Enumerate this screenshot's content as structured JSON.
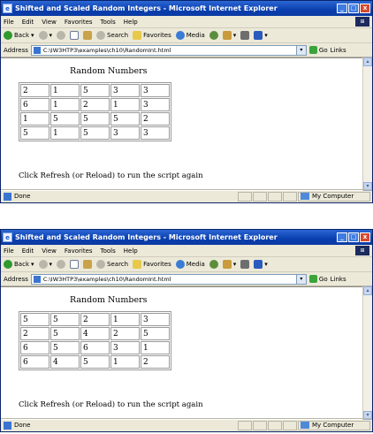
{
  "windows": [
    {
      "title": "Shifted and Scaled Random Integers - Microsoft Internet Explorer",
      "menu": [
        "File",
        "Edit",
        "View",
        "Favorites",
        "Tools",
        "Help"
      ],
      "toolbar": {
        "back": "Back",
        "search": "Search",
        "favorites": "Favorites",
        "media": "Media"
      },
      "address": {
        "label": "Address",
        "value": "C:\\IW3HTP3\\examples\\ch10\\RandomInt.html",
        "go": "Go",
        "links": "Links"
      },
      "heading": "Random Numbers",
      "rows": [
        [
          "2",
          "1",
          "5",
          "3",
          "3"
        ],
        [
          "6",
          "1",
          "2",
          "1",
          "3"
        ],
        [
          "1",
          "5",
          "5",
          "5",
          "2"
        ],
        [
          "5",
          "1",
          "5",
          "3",
          "3"
        ]
      ],
      "footer": "Click Refresh (or Reload) to run the script again",
      "status": {
        "left": "Done",
        "zone": "My Computer"
      }
    },
    {
      "title": "Shifted and Scaled Random Integers - Microsoft Internet Explorer",
      "menu": [
        "File",
        "Edit",
        "View",
        "Favorites",
        "Tools",
        "Help"
      ],
      "toolbar": {
        "back": "Back",
        "search": "Search",
        "favorites": "Favorites",
        "media": "Media"
      },
      "address": {
        "label": "Address",
        "value": "C:\\IW3HTP3\\examples\\ch10\\RandomInt.html",
        "go": "Go",
        "links": "Links"
      },
      "heading": "Random Numbers",
      "rows": [
        [
          "5",
          "5",
          "2",
          "1",
          "3"
        ],
        [
          "2",
          "5",
          "4",
          "2",
          "5"
        ],
        [
          "6",
          "5",
          "6",
          "3",
          "1"
        ],
        [
          "6",
          "4",
          "5",
          "1",
          "2"
        ]
      ],
      "footer": "Click Refresh (or Reload) to run the script again",
      "status": {
        "left": "Done",
        "zone": "My Computer"
      }
    }
  ]
}
